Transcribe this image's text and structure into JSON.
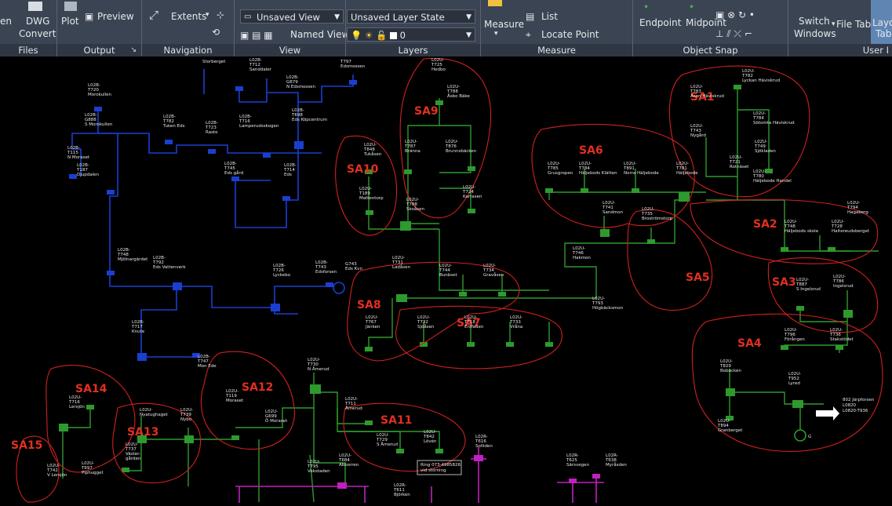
{
  "ribbon": {
    "buttons": {
      "open": "en",
      "dwg_convert_1": "DWG",
      "dwg_convert_2": "Convert",
      "plot": "Plot",
      "preview": "Preview",
      "extents": "Extents",
      "named_views": "Named Views",
      "measure": "Measure",
      "list": "List",
      "locate_point": "Locate Point",
      "endpoint": "Endpoint",
      "midpoint": "Midpoint",
      "switch_windows_1": "Switch",
      "switch_windows_2": "Windows",
      "file_tabs": "File Tabs",
      "layout_tabs_1": "Layo",
      "layout_tabs_2": "Tabs"
    },
    "view_combo": "Unsaved View",
    "layer_state_combo": "Unsaved Layer State",
    "layer_combo": "0",
    "groups": {
      "files": "Files",
      "output": "Output",
      "navigation": "Navigation",
      "view": "View",
      "layers": "Layers",
      "measure": "Measure",
      "object_snap": "Object Snap",
      "user": "User I"
    }
  },
  "colors": {
    "ribbon_bg": "#3b4453",
    "canvas_bg": "#000000",
    "blue_network": "#1a3fd0",
    "green_network": "#2e9a2e",
    "magenta_network": "#c020c0",
    "region_outline": "#d02020",
    "region_label": "#e03020"
  },
  "regions": [
    "SA1",
    "SA2",
    "SA3",
    "SA4",
    "SA5",
    "SA6",
    "SA7",
    "SA8",
    "SA9",
    "SA10",
    "SA11",
    "SA12",
    "SA13",
    "SA14",
    "SA15"
  ],
  "stations": {
    "marokullen": "L02B-\nT720\nMorokullen",
    "s_marokullen": "L02B-\nG888\nS Morokullen",
    "nmoraset": "L02B-\nT115\nN Moraset",
    "djupdalen": "L02B-\nT187\nDjupdalen",
    "tukan": "L02B-\nT782\nTuken Eds",
    "rastie": "L02B-\nT723\nRaste",
    "lamperud": "L02B-\nT716\nLamperudsskogen",
    "edskop": "L02B-\nT698\nEds Köpcentrum",
    "nedsmossen": "L02B-\nG879\nN Edsmossen",
    "edsgard": "L02B-\nT745\nEds gård",
    "eds": "L02B-\nT714\nEds",
    "mjolnar": "L02B-\nT748\nMjölnargärdet",
    "vattenverk": "L02B-\nT792\nEds Vattenverk",
    "lyckebo": "L02B-\nT726\nLyckebo",
    "edsforsen": "L02B-\nT743\nEdsforsen",
    "edskvn": "G743\nEds Kvn",
    "knute": "L02B-\nT717\nKnute",
    "monede": "L02B-\nT747\nMon Ede",
    "tukasen": "L02U-\nT848\nTukåsen",
    "mattentorp": "L02U-\nT189\nMattentorp",
    "branna": "L02U-\nT787\nBrännа",
    "skoasen": "L02U-\nT788\nSkoåsen",
    "hedbo": "L02U-\nT725\nHedbo",
    "asbo": "L02U-\nT788\nÅsbo Bäke",
    "brunnen": "L02U-\nT876\nBrunnsbäcken",
    "karrasen": "L02U-\nT724\nKarrasen",
    "grusgropen": "L02U-\nT785\nGrusgropen",
    "klatten": "L02U-\nT784\nHäljebods Klätten",
    "nhaljebo": "L02U-\nT891\nNorra Häljebode",
    "haljebo": "L02U-\nT781\nHäljebode",
    "sandmon": "L02U-\nT741\nSandmon",
    "brostrom": "L02U-\nT735\nBroströmstorp",
    "hakmon": "L02U-\nT746\nHakmon",
    "hogbacken": "L02U-\nT793\nHögbäcksmon",
    "ladasen": "L02U-\nT731\nLadåsen",
    "bunbset": "L02U-\nT744\nBunbset",
    "gravasen": "L02U-\nT734\nGravåsen",
    "janken": "L02U-\nT767\nJänken",
    "sjoasen": "L02U-\nT732\nSjöåsen",
    "entiaden": "L02U-\nT718\nEntiaden",
    "vrana": "L02U-\nT733\nVråna",
    "lyckan": "L02U-\nT782\nLyckan Häviskrud",
    "asen": "L02U-\nT783\nÅsen Häviskrud",
    "sotomta": "L02U-\nT784\nSötomta Häviskrud",
    "nygard": "L02U-\nT743\nNygård",
    "rotnaset": "L02U-\nT721\nRotnäset",
    "sjoklen": "L02U-\nT749\nSjökladen",
    "haljebo_handel": "L02U-\nT780\nHäljebode Handel",
    "hagaberg": "L02U-\nT794\nHagaberg",
    "haljebo_skola": "L02U-\nT748\nHäljebods skola",
    "haltered": "L02U-\nT728\nHaltereudsberget",
    "singelsrud": "L02U-\nT887\nS Ingelsrud",
    "ingelsrud": "L02U-\nT786\nIngelsrud",
    "forangen": "L02U-\nT796\nFörången",
    "stakstodet": "L02U-\nT736\nStakstödet",
    "bobacken": "L02U-\nT829\nBobäcken",
    "lyred": "L02U-\nT952\nLyred",
    "granberget": "L02U-\nT894\nGranberget",
    "namerud": "L02U-\nT730\nN Åmerud",
    "amerud": "L02U-\nT711\nÅmerud",
    "samerud": "L02U-\nT729\nS Åmerud",
    "loven": "L02U-\nT842\nLövén",
    "moraset": "L02U-\nT119\nMoraset",
    "omoraset": "L02U-\nG699\nÖ Moraset",
    "nybo": "L02U-\nT739\nNybo",
    "nyatughaget": "L02U-\nNyatughaget",
    "vaster": "L02U-\nT737\nVäster-\ngården",
    "lersjon": "L02U-\nT716\nLersjön",
    "vlersjon": "L02U-\nT742\nV Lersjön",
    "piphugget": "L02U-\nT697\nPiphugget",
    "vekstaden": "L02U-\nT795\nVekstaden",
    "abborren": "L02U-\nT684\nAbborren",
    "solliden": "L02R-\nT616\nSolliden",
    "sarsvegen": "L02R-\nT625\nSärsvegen",
    "myrasden": "L02R-\nT638\nMyråsden",
    "bjorken": "L02R-\nT611\nBjörken",
    "starberget": "Storberget",
    "sanddaler": "L02B-\nT712\nSanddaler",
    "edsmossen": "T797\nEdsmossen"
  },
  "notes": {
    "ring": "Ring 073-4985826\nvid störning",
    "bridge": "802 Järpforsen\nL0820\nL0820-T936",
    "g_label": "G"
  }
}
